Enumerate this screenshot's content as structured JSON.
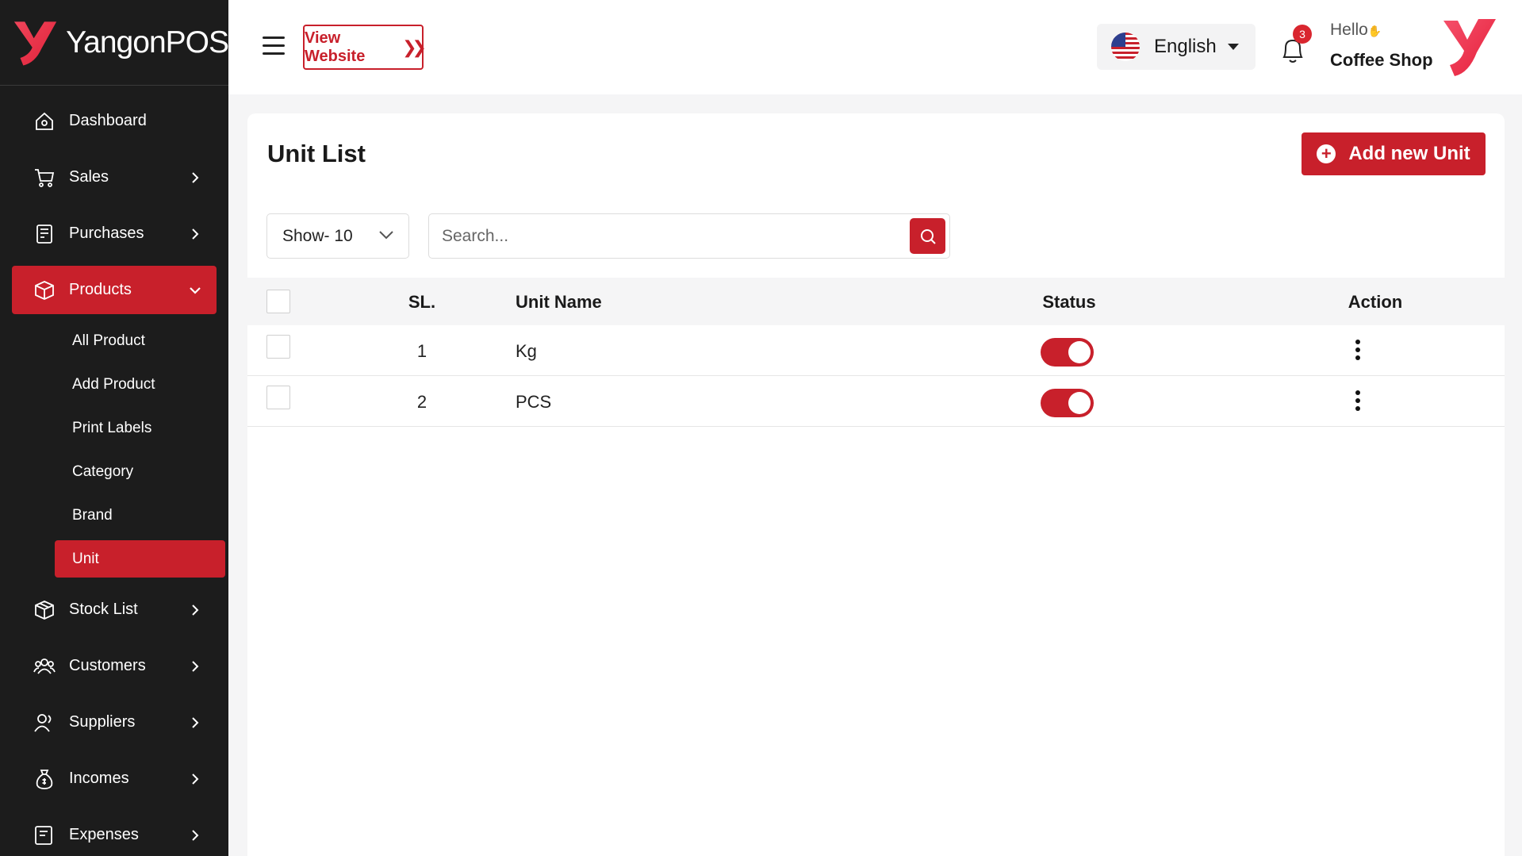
{
  "brand": {
    "name": "YangonPOS"
  },
  "sidebar": {
    "items": [
      {
        "label": "Dashboard",
        "icon": "home-icon",
        "has_chevron": false
      },
      {
        "label": "Sales",
        "icon": "cart-icon",
        "has_chevron": true
      },
      {
        "label": "Purchases",
        "icon": "receipt-icon",
        "has_chevron": true
      },
      {
        "label": "Products",
        "icon": "box-icon",
        "has_chevron": true,
        "active": true,
        "expanded": true
      },
      {
        "label": "Stock List",
        "icon": "package-icon",
        "has_chevron": true
      },
      {
        "label": "Customers",
        "icon": "users-icon",
        "has_chevron": true
      },
      {
        "label": "Suppliers",
        "icon": "supplier-icon",
        "has_chevron": true
      },
      {
        "label": "Incomes",
        "icon": "money-bag-icon",
        "has_chevron": true
      },
      {
        "label": "Expenses",
        "icon": "expense-icon",
        "has_chevron": true
      }
    ],
    "products_sub": [
      {
        "label": "All Product"
      },
      {
        "label": "Add Product"
      },
      {
        "label": "Print Labels"
      },
      {
        "label": "Category"
      },
      {
        "label": "Brand"
      },
      {
        "label": "Unit",
        "active": true
      }
    ]
  },
  "header": {
    "view_website_label": "View Website",
    "language": "English",
    "notification_count": "3",
    "greeting": "Hello",
    "shop_name": "Coffee Shop"
  },
  "main": {
    "title": "Unit List",
    "add_button_label": "Add new Unit",
    "show_select_value": "Show- 10",
    "search_placeholder": "Search...",
    "table": {
      "headers": {
        "sl": "SL.",
        "name": "Unit Name",
        "status": "Status",
        "action": "Action"
      },
      "rows": [
        {
          "sl": "1",
          "name": "Kg",
          "status_on": true
        },
        {
          "sl": "2",
          "name": "PCS",
          "status_on": true
        }
      ]
    }
  },
  "colors": {
    "accent": "#c8202b",
    "sidebar_bg": "#1c1c1c",
    "page_bg": "#f5f5f6"
  }
}
